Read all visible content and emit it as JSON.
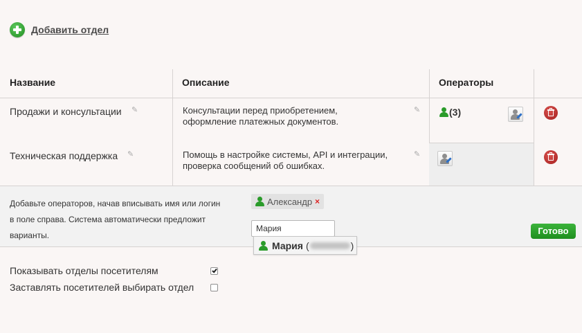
{
  "add_department": {
    "label": "Добавить отдел"
  },
  "table": {
    "headers": {
      "name": "Название",
      "description": "Описание",
      "operators": "Операторы"
    },
    "rows": [
      {
        "name": "Продажи и консультации",
        "description_line1": "Консультации перед приобретением,",
        "description_line2": "оформление платежных документов.",
        "operators_count": "(3)"
      },
      {
        "name": "Техническая поддержка",
        "description_line1": "Помощь в настройке системы, API и интеграции,",
        "description_line2": "проверка сообщений об ошибках.",
        "operators_count": ""
      }
    ]
  },
  "operator_panel": {
    "hint_line1": "Добавьте операторов, начав вписывать имя или логин",
    "hint_line2": "в поле справа. Система автоматически предложит",
    "hint_line3": "варианты.",
    "selected_operator": "Александр",
    "remove_symbol": "×",
    "search_value": "Мария",
    "done_label": "Готово",
    "suggestion": {
      "name": "Мария",
      "open_paren": "(",
      "close_paren": ")"
    }
  },
  "options": {
    "show_departments": {
      "label": "Показывать отделы посетителям",
      "checked": true
    },
    "force_select": {
      "label": "Заставлять посетителей выбирать отдел",
      "checked": false
    }
  },
  "colors": {
    "background": "#faf6f5",
    "accent_green": "#2a9b2a",
    "delete_red": "#c0302d",
    "assign_pen_blue": "#2d6fc6"
  },
  "icons": {
    "add": "plus-circle-icon",
    "edit": "pencil-icon",
    "operator": "person-icon",
    "assign": "assign-operator-icon",
    "delete": "trash-icon"
  }
}
